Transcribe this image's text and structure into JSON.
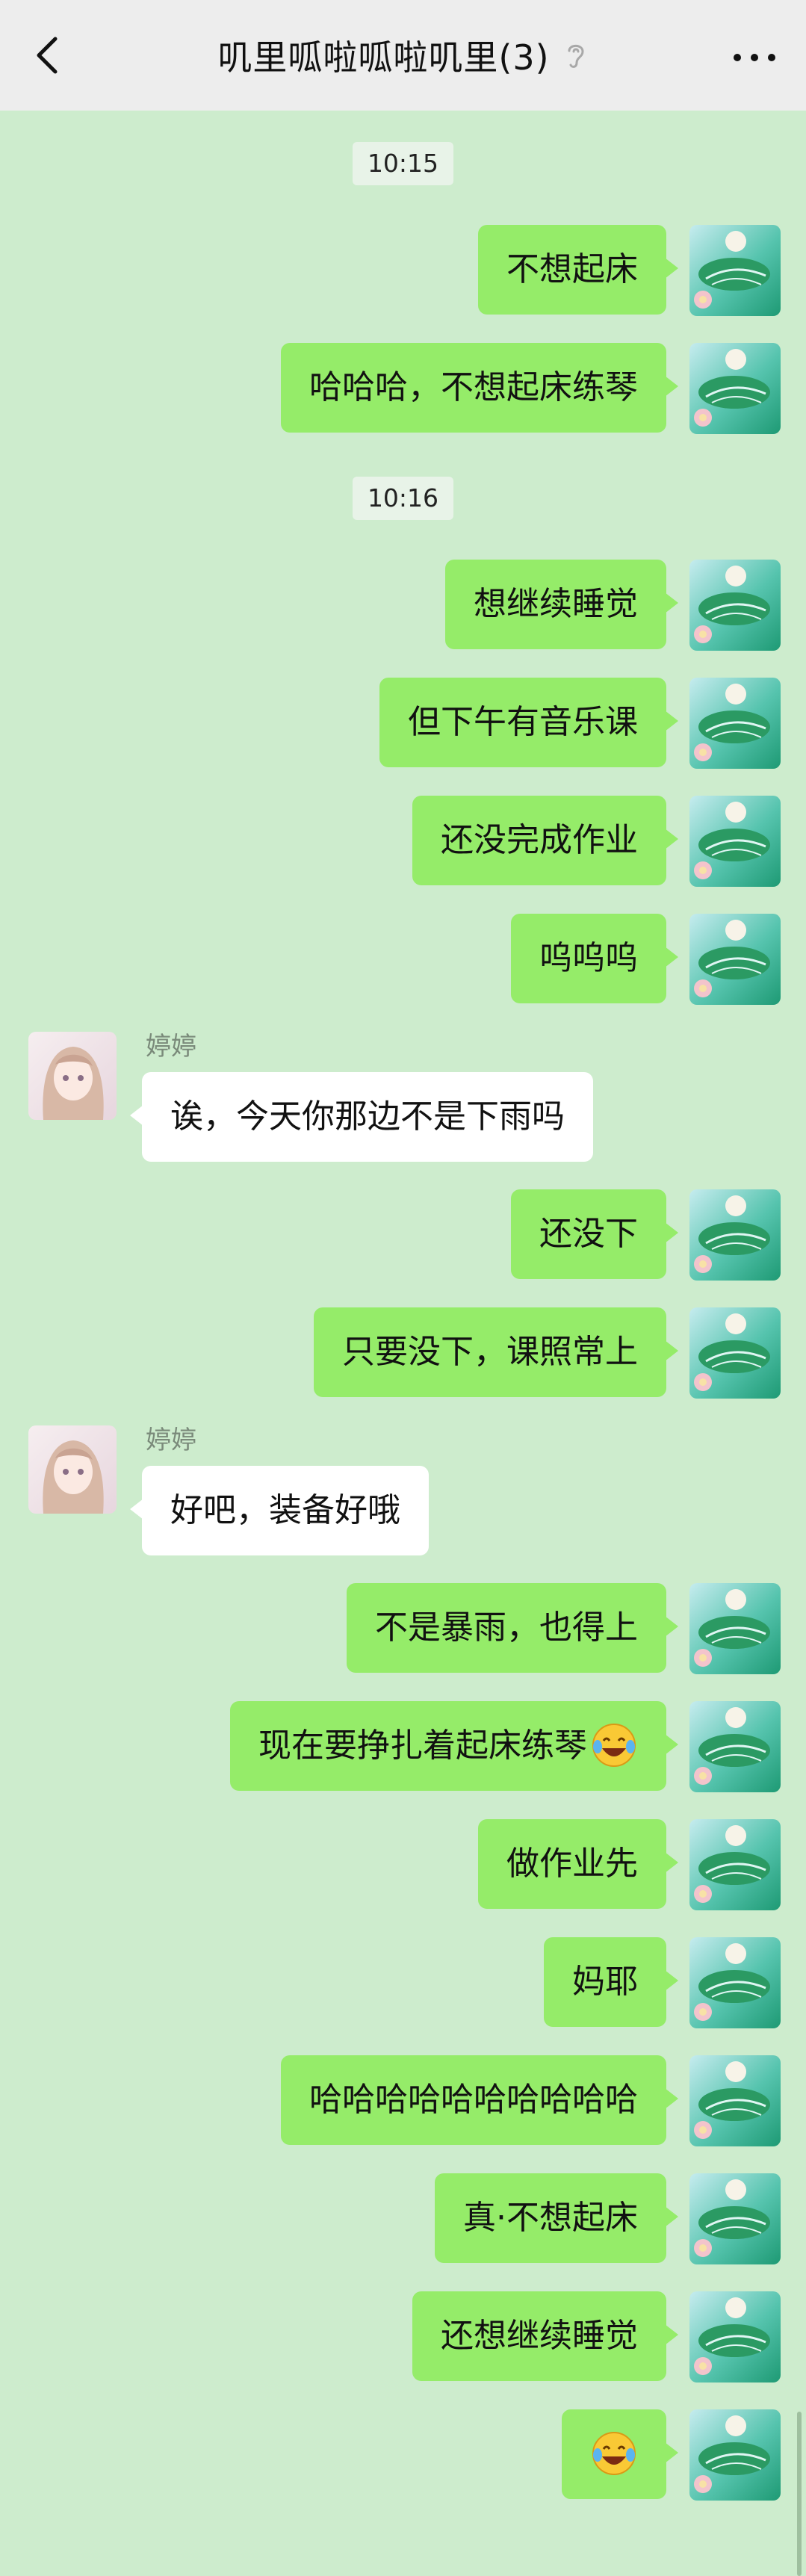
{
  "header": {
    "title": "叽里呱啦呱啦叽里(3)",
    "back_icon": "chevron-left-icon",
    "mute_icon": "ear-mute-icon",
    "more_icon": "more-dots-icon"
  },
  "colors": {
    "header_bg": "#ededed",
    "chat_bg": "#cdeccd",
    "my_bubble": "#95ec69",
    "other_bubble": "#ffffff"
  },
  "timestamps": [
    "10:15",
    "10:16"
  ],
  "messages": [
    {
      "sender": "",
      "text": "不想起床",
      "mine": true
    },
    {
      "sender": "",
      "text": "哈哈哈，不想起床练琴",
      "mine": true
    },
    {
      "sender": "",
      "text": "想继续睡觉",
      "mine": true
    },
    {
      "sender": "",
      "text": "但下午有音乐课",
      "mine": true
    },
    {
      "sender": "",
      "text": "还没完成作业",
      "mine": true
    },
    {
      "sender": "",
      "text": "呜呜呜",
      "mine": true
    },
    {
      "sender": "婷婷",
      "text": "诶，今天你那边不是下雨吗",
      "mine": false
    },
    {
      "sender": "",
      "text": "还没下",
      "mine": true
    },
    {
      "sender": "",
      "text": "只要没下，课照常上",
      "mine": true
    },
    {
      "sender": "婷婷",
      "text": "好吧，装备好哦",
      "mine": false
    },
    {
      "sender": "",
      "text": "不是暴雨，也得上",
      "mine": true
    },
    {
      "sender": "",
      "text": "现在要挣扎着起床练琴",
      "mine": true,
      "emoji": "laugh-cry-emoji"
    },
    {
      "sender": "",
      "text": "做作业先",
      "mine": true
    },
    {
      "sender": "",
      "text": "妈耶",
      "mine": true
    },
    {
      "sender": "",
      "text": "哈哈哈哈哈哈哈哈哈哈",
      "mine": true
    },
    {
      "sender": "",
      "text": "真·不想起床",
      "mine": true
    },
    {
      "sender": "",
      "text": "还想继续睡觉",
      "mine": true
    },
    {
      "sender": "",
      "text": "",
      "mine": true,
      "emoji": "laugh-cry-emoji"
    }
  ]
}
